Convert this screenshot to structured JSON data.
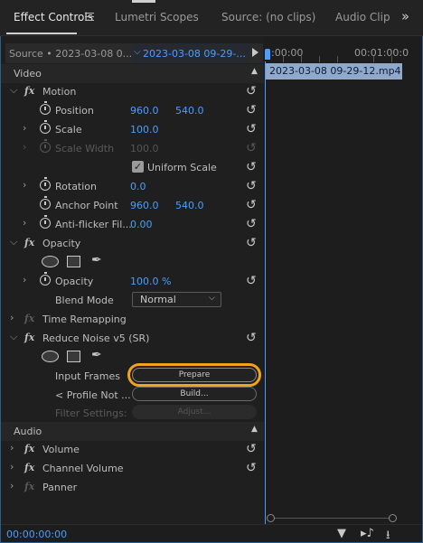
{
  "tabs": [
    {
      "label": "Effect Controls"
    },
    {
      "label": "Lumetri Scopes"
    },
    {
      "label": "Source: (no clips)"
    },
    {
      "label": "Audio Clip"
    }
  ],
  "source_bar": {
    "source_label": "Source • 2023-03-08 0...",
    "clip_label": "2023-03-08 09-29-..."
  },
  "sections": {
    "video": "Video",
    "audio": "Audio"
  },
  "effects": {
    "motion": {
      "name": "Motion",
      "position": {
        "label": "Position",
        "x": "960.0",
        "y": "540.0"
      },
      "scale": {
        "label": "Scale",
        "value": "100.0"
      },
      "scale_width": {
        "label": "Scale Width",
        "value": "100.0"
      },
      "uniform_scale": {
        "label": "Uniform Scale",
        "checked": true
      },
      "rotation": {
        "label": "Rotation",
        "value": "0.0"
      },
      "anchor_point": {
        "label": "Anchor Point",
        "x": "960.0",
        "y": "540.0"
      },
      "anti_flicker": {
        "label": "Anti-flicker Fil...",
        "value": "0.00"
      }
    },
    "opacity": {
      "name": "Opacity",
      "opacity": {
        "label": "Opacity",
        "value": "100.0 %"
      },
      "blend_mode": {
        "label": "Blend Mode",
        "value": "Normal"
      }
    },
    "time_remapping": {
      "name": "Time Remapping"
    },
    "reduce_noise": {
      "name": "Reduce Noise v5 (SR)",
      "input_frames": {
        "label": "Input Frames",
        "button": "Prepare"
      },
      "profile": {
        "label": "< Profile Not ...",
        "button": "Build..."
      },
      "filter_settings": {
        "label": "Filter Settings:",
        "button": "Adjust..."
      }
    },
    "volume": {
      "name": "Volume"
    },
    "channel_volume": {
      "name": "Channel Volume"
    },
    "panner": {
      "name": "Panner"
    }
  },
  "timeline": {
    "time_start": ":00:00",
    "time_end": "00:01:00:0",
    "clip_name": "2023-03-08 09-29-12.mp4"
  },
  "bottom": {
    "timecode": "00:00:00:00"
  },
  "icons": {
    "menu": "hamburger-menu-icon",
    "overflow": "double-chevron-right-icon",
    "stopwatch": "stopwatch-icon",
    "reset": "reset-parameter-icon",
    "ellipse_mask": "ellipse-mask-icon",
    "rect_mask": "rectangle-mask-icon",
    "pen_mask": "pen-mask-icon",
    "filter": "filter-icon",
    "audio_only": "audio-only-icon",
    "export": "export-icon"
  },
  "colors": {
    "accent": "#4a9eff",
    "highlight": "#f0a31c",
    "clip": "#8fa9cc"
  }
}
